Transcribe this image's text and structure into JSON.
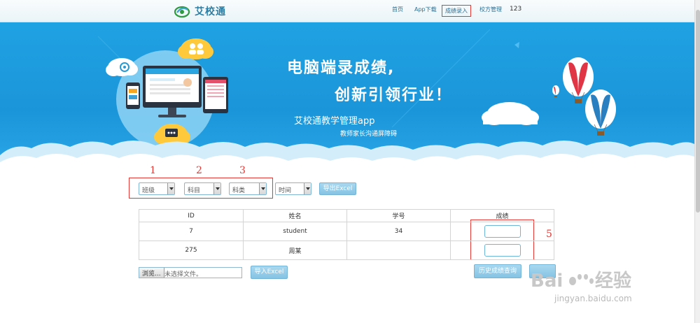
{
  "nav": {
    "brand": "艾校通",
    "home": "首页",
    "app_download": "App下载",
    "grade_entry": "成绩录入",
    "school_manage": "校方管理",
    "user": "123"
  },
  "banner": {
    "headline1": "电脑端录成绩,",
    "headline2": "创新引领行业！",
    "sub1": "艾校通教学管理app",
    "sub2": "教师家长沟通屏障碍"
  },
  "annotations": {
    "n1": "1",
    "n2": "2",
    "n3": "3",
    "n5": "5"
  },
  "filters": {
    "class": "班级",
    "subject": "科目",
    "category": "科类",
    "time": "时间",
    "export": "导出Excel"
  },
  "table": {
    "headers": [
      "ID",
      "姓名",
      "学号",
      "成绩"
    ],
    "rows": [
      {
        "id": "7",
        "name": "student",
        "student_no": "34"
      },
      {
        "id": "275",
        "name": "周某",
        "student_no": ""
      }
    ]
  },
  "bottom": {
    "browse": "浏览...",
    "no_file": "未选择文件。",
    "import": "导入Excel",
    "history": "历史成绩查询"
  },
  "watermark": {
    "brand": "Baidu经验",
    "url": "jingyan.baidu.com"
  },
  "colors": {
    "banner_blue": "#1fa2e3",
    "button_blue": "#84c3e4",
    "annotation_red": "#e53935"
  }
}
